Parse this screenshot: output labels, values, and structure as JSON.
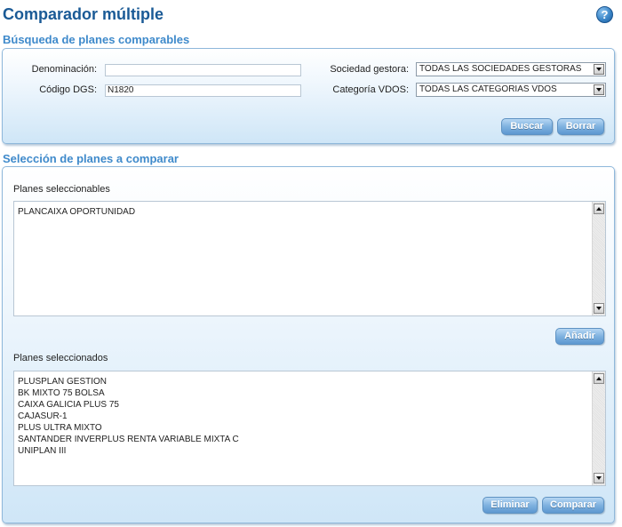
{
  "header": {
    "title": "Comparador múltiple",
    "help_label": "?"
  },
  "search": {
    "section_title": "Búsqueda de planes comparables",
    "denominacion_label": "Denominación:",
    "denominacion_value": "",
    "codigo_label": "Código DGS:",
    "codigo_value": "N1820",
    "sociedad_label": "Sociedad gestora:",
    "sociedad_value": "TODAS LAS SOCIEDADES GESTORAS",
    "categoria_label": "Categoría VDOS:",
    "categoria_value": "TODAS LAS CATEGORIAS VDOS",
    "buscar_label": "Buscar",
    "borrar_label": "Borrar"
  },
  "selection": {
    "section_title": "Selección de planes a comparar",
    "seleccionables_label": "Planes seleccionables",
    "seleccionables": [
      "PLANCAIXA OPORTUNIDAD"
    ],
    "anadir_label": "Añadir",
    "seleccionados_label": "Planes seleccionados",
    "seleccionados": [
      "PLUSPLAN GESTION",
      "BK MIXTO 75 BOLSA",
      "CAIXA GALICIA PLUS 75",
      "CAJASUR-1",
      "PLUS ULTRA MIXTO",
      "SANTANDER INVERPLUS RENTA VARIABLE MIXTA C",
      "UNIPLAN III"
    ],
    "eliminar_label": "Eliminar",
    "comparar_label": "Comparar"
  },
  "icons": {
    "help": "help-icon",
    "dropdown": "chevron-down-icon",
    "scroll_up": "scroll-up-icon",
    "scroll_down": "scroll-down-icon"
  }
}
